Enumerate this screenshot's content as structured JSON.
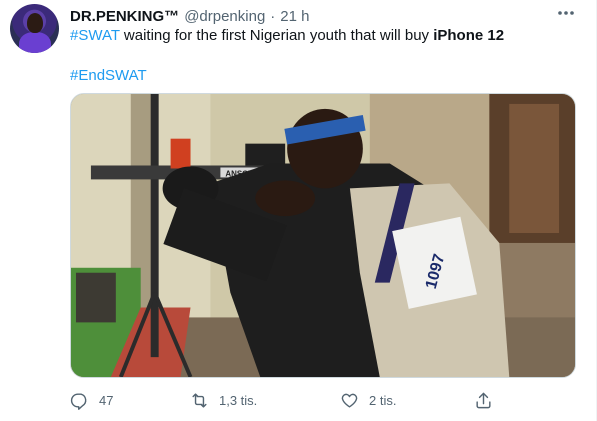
{
  "tweet": {
    "author_name": "DR.PENKING™",
    "handle": "@drpenking",
    "separator": "·",
    "time": "21 h",
    "line1_hashtag": "#SWAT",
    "line1_text": " waiting for the first Nigerian youth that will buy ",
    "line1_bold": "iPhone 12",
    "line2_hashtag": "#EndSWAT"
  },
  "media": {
    "rifle_label": "ANSCHUTZ",
    "bib_number": "1097"
  },
  "actions": {
    "reply_count": "47",
    "retweet_count": "1,3 tis.",
    "like_count": "2 tis.",
    "reply_icon": "reply-icon",
    "retweet_icon": "retweet-icon",
    "like_icon": "heart-icon",
    "share_icon": "share-icon"
  },
  "colors": {
    "accent": "#1d9bf0",
    "secondary_text": "#536471",
    "primary_text": "#0f1419"
  }
}
